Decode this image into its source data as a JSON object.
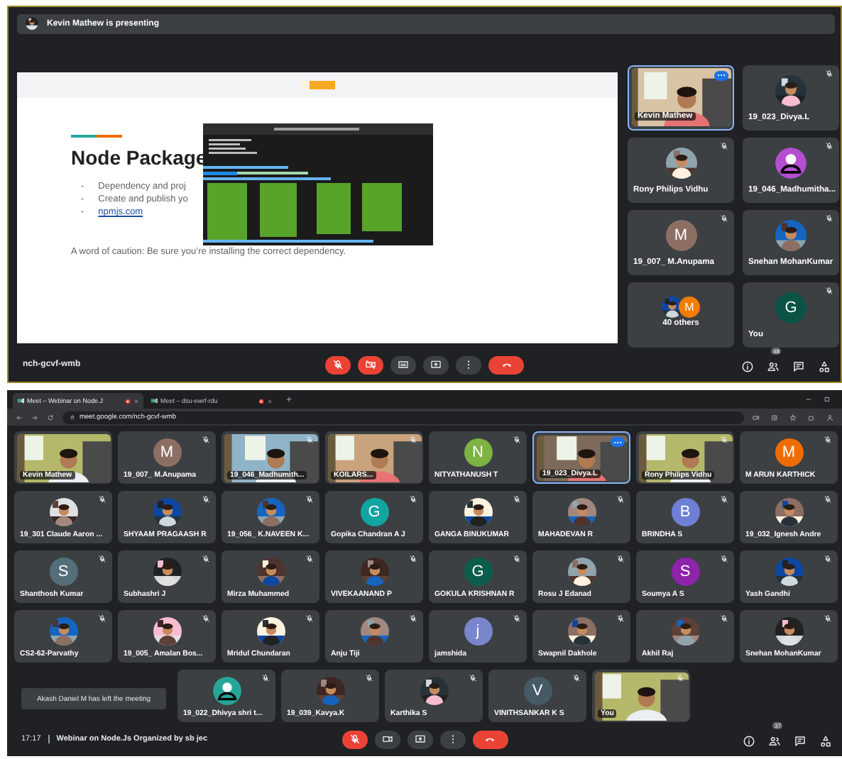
{
  "presentation": {
    "banner": "Kevin Mathew is presenting",
    "slide": {
      "title": "Node Package",
      "bullets": [
        {
          "marker": "-",
          "text": "Dependency and proj",
          "link": false
        },
        {
          "marker": "-",
          "text": "Create and publish yo",
          "link": false
        },
        {
          "marker": "-",
          "text": "npmjs.com",
          "link": true
        }
      ],
      "note": "A word of caution: Be sure you’re installing the correct dependency."
    },
    "tiles": [
      {
        "name": "Kevin Mathew",
        "kind": "video",
        "muted": false,
        "highlighted": true,
        "options": true
      },
      {
        "name": "19_023_Divya.L",
        "muted": true,
        "highlighted": false,
        "options": false
      },
      {
        "name": "Rony Philips Vidhu",
        "muted": true,
        "highlighted": false,
        "options": false
      },
      {
        "name": "19_046_Madhumitha...",
        "kind": "silhouette",
        "color": "#b44fd1",
        "muted": true,
        "highlighted": false,
        "options": false
      },
      {
        "name": "19_007_ M.Anupama",
        "kind": "letter",
        "letter": "M",
        "color": "#8d6e63",
        "muted": true,
        "highlighted": false,
        "options": false
      },
      {
        "name": "Snehan MohanKumar",
        "muted": true,
        "highlighted": false,
        "options": false
      },
      {
        "name": "40 others",
        "kind": "others",
        "letter": "M",
        "color": "#f57c00",
        "muted": false,
        "highlighted": false,
        "options": false
      },
      {
        "name": "You",
        "kind": "letter",
        "letter": "G",
        "color": "#0b5345",
        "muted": true,
        "highlighted": false,
        "options": false
      }
    ],
    "meeting_code": "nch-gcvf-wmb",
    "controls": [
      {
        "kind": "mic",
        "off": true
      },
      {
        "kind": "camera",
        "off": true
      },
      {
        "kind": "captions",
        "off": false
      },
      {
        "kind": "present",
        "off": false
      },
      {
        "kind": "more",
        "off": false
      },
      {
        "kind": "hangup",
        "off": false
      }
    ],
    "side_buttons": [
      {
        "kind": "info"
      },
      {
        "kind": "people",
        "badge": "48"
      },
      {
        "kind": "chat"
      },
      {
        "kind": "activities"
      }
    ]
  },
  "browser": {
    "tabs": [
      {
        "title": "Meet – Webinar on Node.J",
        "selected": true
      },
      {
        "title": "Meet – dsu-ewrf-rdu",
        "selected": false
      }
    ],
    "address": "meet.google.com/nch-gcvf-wmb"
  },
  "gallery": {
    "rows": [
      {
        "tiles": [
          {
            "name": "Kevin Mathew",
            "kind": "video",
            "muted": false,
            "highlighted": false,
            "options": false
          },
          {
            "name": "19_007_ M.Anupama",
            "kind": "letter",
            "letter": "M",
            "color": "#8d6e63",
            "muted": true,
            "highlighted": false,
            "options": false
          },
          {
            "name": "19_046_Madhumith...",
            "kind": "video",
            "muted": true,
            "highlighted": false,
            "options": false
          },
          {
            "name": "KOILARS...",
            "kind": "video",
            "muted": true,
            "highlighted": false,
            "options": false
          },
          {
            "name": "NITYATHANUSH T",
            "kind": "letter",
            "letter": "N",
            "color": "#7cb342",
            "muted": true,
            "highlighted": false,
            "options": false
          },
          {
            "name": "19_023_Divya.L",
            "kind": "video",
            "muted": false,
            "highlighted": true,
            "options": true
          },
          {
            "name": "Rony Philips Vidhu",
            "kind": "video",
            "muted": true,
            "highlighted": false,
            "options": false
          },
          {
            "name": "M ARUN KARTHICK",
            "kind": "letter",
            "letter": "M",
            "color": "#ef6c00",
            "muted": true,
            "highlighted": false,
            "options": false
          }
        ]
      },
      {
        "tiles": [
          {
            "name": "19_301 Claude Aaron ...",
            "muted": true,
            "highlighted": false,
            "options": false
          },
          {
            "name": "SHYAAM PRAGAASH R",
            "muted": true,
            "highlighted": false,
            "options": false
          },
          {
            "name": "19_056_ K.NAVEEN K...",
            "muted": true,
            "highlighted": false,
            "options": false
          },
          {
            "name": "Gopika Chandran A J",
            "kind": "letter",
            "letter": "G",
            "color": "#12a4a0",
            "muted": true,
            "highlighted": false,
            "options": false
          },
          {
            "name": "GANGA BINUKUMAR",
            "muted": true,
            "highlighted": false,
            "options": false
          },
          {
            "name": "MAHADEVAN R",
            "muted": true,
            "highlighted": false,
            "options": false
          },
          {
            "name": "BRINDHA S",
            "kind": "letter",
            "letter": "B",
            "color": "#6e7fd6",
            "muted": true,
            "highlighted": false,
            "options": false
          },
          {
            "name": "19_032_Ignesh Andre",
            "muted": true,
            "highlighted": false,
            "options": false
          }
        ]
      },
      {
        "tiles": [
          {
            "name": "Shanthosh Kumar",
            "kind": "letter",
            "letter": "S",
            "color": "#546e7a",
            "muted": true,
            "highlighted": false,
            "options": false
          },
          {
            "name": "Subhashri J",
            "muted": true,
            "highlighted": false,
            "options": false
          },
          {
            "name": "Mirza Muhammed",
            "muted": true,
            "highlighted": false,
            "options": false
          },
          {
            "name": "VIVEKAANAND P",
            "muted": true,
            "highlighted": false,
            "options": false
          },
          {
            "name": "GOKULA KRISHNAN R",
            "kind": "letter",
            "letter": "G",
            "color": "#0b5e4d",
            "muted": true,
            "highlighted": false,
            "options": false
          },
          {
            "name": "Rosu J Edanad",
            "muted": true,
            "highlighted": false,
            "options": false
          },
          {
            "name": "Soumya A S",
            "kind": "letter",
            "letter": "S",
            "color": "#8e24aa",
            "muted": true,
            "highlighted": false,
            "options": false
          },
          {
            "name": "Yash Gandhi",
            "muted": true,
            "highlighted": false,
            "options": false
          }
        ]
      },
      {
        "tiles": [
          {
            "name": "CS2-62-Parvathy",
            "muted": true,
            "highlighted": false,
            "options": false
          },
          {
            "name": "19_005_ Amalan Bos...",
            "muted": true,
            "highlighted": false,
            "options": false
          },
          {
            "name": "Mridul Chundaran",
            "muted": true,
            "highlighted": false,
            "options": false
          },
          {
            "name": "Anju Tiji",
            "muted": true,
            "highlighted": false,
            "options": false
          },
          {
            "name": "jamshida",
            "kind": "letter",
            "letter": "j",
            "color": "#7986cb",
            "muted": true,
            "highlighted": false,
            "options": false
          },
          {
            "name": "Swapnil Dakhole",
            "muted": true,
            "highlighted": false,
            "options": false
          },
          {
            "name": "Akhil Raj",
            "muted": true,
            "highlighted": false,
            "options": false
          },
          {
            "name": "Snehan MohanKumar",
            "muted": true,
            "highlighted": false,
            "options": false
          }
        ]
      },
      {
        "tiles": [
          {
            "name": "19_022_Dhivya shri t...",
            "kind": "silhouette",
            "color": "#26a69a",
            "muted": true,
            "highlighted": false,
            "options": false
          },
          {
            "name": "19_039_Kavya.K",
            "muted": true,
            "highlighted": false,
            "options": false
          },
          {
            "name": "Karthika S",
            "muted": true,
            "highlighted": false,
            "options": false
          },
          {
            "name": "VINITHSANKAR K S",
            "kind": "letter",
            "letter": "V",
            "color": "#455a64",
            "muted": true,
            "highlighted": false,
            "options": false
          },
          {
            "name": "You",
            "kind": "video",
            "muted": true,
            "highlighted": false,
            "options": false
          }
        ]
      }
    ],
    "toast": "Akash Daniel M has left the meeting",
    "time": "17:17",
    "title": "Webinar on Node.Js Organized by sb jec",
    "controls": [
      {
        "kind": "mic",
        "off": true
      },
      {
        "kind": "camera",
        "off": false
      },
      {
        "kind": "present",
        "off": false
      },
      {
        "kind": "more",
        "off": false
      },
      {
        "kind": "hangup",
        "off": false
      }
    ],
    "side_buttons": [
      {
        "kind": "info"
      },
      {
        "kind": "people",
        "badge": "37"
      },
      {
        "kind": "chat"
      },
      {
        "kind": "activities"
      }
    ]
  }
}
